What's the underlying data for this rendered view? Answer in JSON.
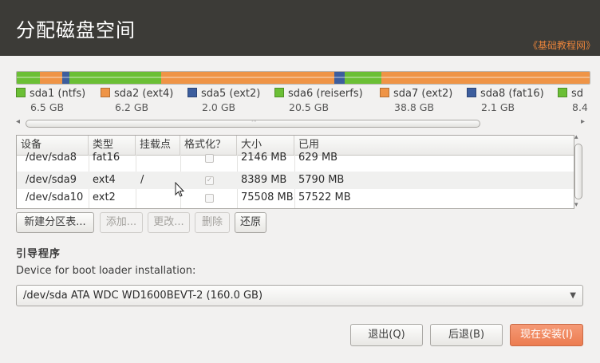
{
  "window": {
    "title": "分配磁盘空间",
    "watermark": "《基础教程网》"
  },
  "colors": {
    "ntfs": "#6bbf35",
    "ext4": "#ef9446",
    "ext2": "#3d5e9e",
    "reiserfs": "#6bbf35",
    "fat16": "#3d5e9e",
    "header_bg": "#3c3b37",
    "accent": "#ec7c50"
  },
  "partition_bar": {
    "segments": [
      {
        "fs": "ntfs",
        "fraction": 0.04
      },
      {
        "fs": "ext4",
        "fraction": 0.039
      },
      {
        "fs": "ext2",
        "fraction": 0.013
      },
      {
        "fs": "reiserfs",
        "fraction": 0.16
      },
      {
        "fs": "ext4",
        "fraction": 0.303
      },
      {
        "fs": "fat16",
        "fraction": 0.017
      },
      {
        "fs": "reiserfs",
        "fraction": 0.065
      },
      {
        "fs": "ext4",
        "fraction": 0.363
      }
    ]
  },
  "legend": [
    {
      "name": "sda1 (ntfs)",
      "size": "6.5 GB",
      "fs": "ntfs"
    },
    {
      "name": "sda2 (ext4)",
      "size": "6.2 GB",
      "fs": "ext4"
    },
    {
      "name": "sda5 (ext2)",
      "size": "2.0 GB",
      "fs": "ext2"
    },
    {
      "name": "sda6 (reiserfs)",
      "size": "20.5 GB",
      "fs": "reiserfs"
    },
    {
      "name": "sda7 (ext2)",
      "size": "38.8 GB",
      "fs": "ext4"
    },
    {
      "name": "sda8 (fat16)",
      "size": "2.1 GB",
      "fs": "fat16"
    },
    {
      "name": "sd",
      "size": "8.4",
      "fs": "reiserfs"
    }
  ],
  "table": {
    "headers": [
      "设备",
      "类型",
      "挂载点",
      "格式化？",
      "大小",
      "已用"
    ],
    "rows": [
      {
        "device": "/dev/sda8",
        "type": "fat16",
        "mount": "",
        "format": false,
        "size": "2146 MB",
        "used": "629 MB"
      },
      {
        "device": "/dev/sda9",
        "type": "ext4",
        "mount": "/",
        "format": true,
        "size": "8389 MB",
        "used": "5790 MB"
      },
      {
        "device": "/dev/sda10",
        "type": "ext2",
        "mount": "",
        "format": false,
        "size": "75508 MB",
        "used": "57522 MB"
      }
    ]
  },
  "buttons": {
    "new_table": "新建分区表...",
    "add": "添加...",
    "change": "更改...",
    "delete": "删除",
    "revert": "还原"
  },
  "bootloader": {
    "section_title": "引导程序",
    "label": "Device for boot loader installation:",
    "selected": "/dev/sda ATA WDC WD1600BEVT-2 (160.0 GB)"
  },
  "footer": {
    "quit": "退出(Q)",
    "back": "后退(B)",
    "install": "现在安装(I)"
  }
}
